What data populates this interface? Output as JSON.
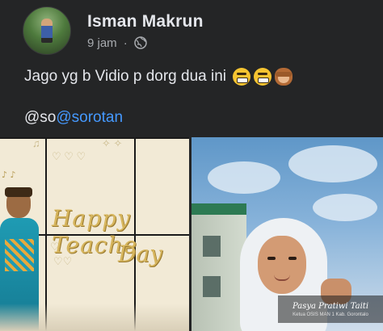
{
  "post": {
    "author": {
      "name": "Isman Makrun",
      "avatar_icon": "profile-photo"
    },
    "meta": {
      "time": "9 jam",
      "separator": "·",
      "privacy_icon": "globe-icon"
    },
    "text": "Jago yg b Vidio p dorg dua ini",
    "emojis": [
      "grimacing-face-emoji",
      "grimacing-face-emoji",
      "see-no-evil-monkey-emoji"
    ],
    "mention": {
      "prefix": "@so",
      "tag": "@sorotan"
    }
  },
  "media": {
    "left_image": {
      "headline_line1": "Happy Teache",
      "headline_line2": "Day"
    },
    "right_image": {
      "caption_name": "Pasya Pratiwi Taiti",
      "caption_role": "Ketua OSIS MAN 1 Kab. Gorontalo"
    }
  },
  "colors": {
    "background": "#242526",
    "text_primary": "#e4e6eb",
    "text_secondary": "#a8abaf",
    "link": "#4599ff"
  }
}
